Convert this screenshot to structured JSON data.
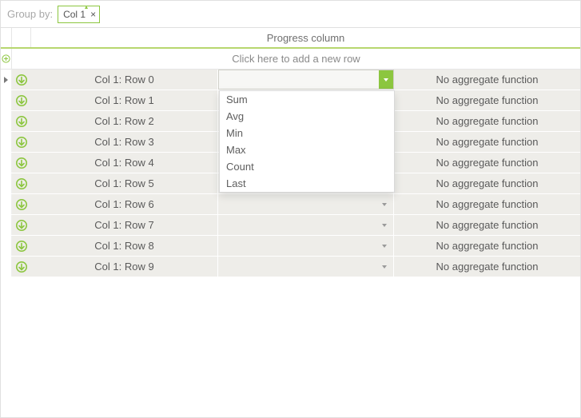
{
  "groupby": {
    "label": "Group by:",
    "chip": "Col 1",
    "close": "×"
  },
  "header": {
    "column_label": "Progress column"
  },
  "addnew": {
    "text": "Click here to add a new row"
  },
  "no_agg_label": "No aggregate function",
  "rows": [
    {
      "col1": "Col 1: Row 0",
      "col3": "No aggregate function",
      "active": true,
      "show_tiny_arrow": false
    },
    {
      "col1": "Col 1: Row 1",
      "col3": "No aggregate function",
      "active": false,
      "show_tiny_arrow": false
    },
    {
      "col1": "Col 1: Row 2",
      "col3": "No aggregate function",
      "active": false,
      "show_tiny_arrow": false
    },
    {
      "col1": "Col 1: Row 3",
      "col3": "No aggregate function",
      "active": false,
      "show_tiny_arrow": false
    },
    {
      "col1": "Col 1: Row 4",
      "col3": "No aggregate function",
      "active": false,
      "show_tiny_arrow": false
    },
    {
      "col1": "Col 1: Row 5",
      "col3": "No aggregate function",
      "active": false,
      "show_tiny_arrow": true
    },
    {
      "col1": "Col 1: Row 6",
      "col3": "No aggregate function",
      "active": false,
      "show_tiny_arrow": true
    },
    {
      "col1": "Col 1: Row 7",
      "col3": "No aggregate function",
      "active": false,
      "show_tiny_arrow": true
    },
    {
      "col1": "Col 1: Row 8",
      "col3": "No aggregate function",
      "active": false,
      "show_tiny_arrow": true
    },
    {
      "col1": "Col 1: Row 9",
      "col3": "No aggregate function",
      "active": false,
      "show_tiny_arrow": true
    }
  ],
  "dropdown": {
    "options": [
      "Sum",
      "Avg",
      "Min",
      "Max",
      "Count",
      "Last"
    ]
  },
  "colors": {
    "accent": "#8cc63f",
    "row_bg": "#eeede9"
  }
}
